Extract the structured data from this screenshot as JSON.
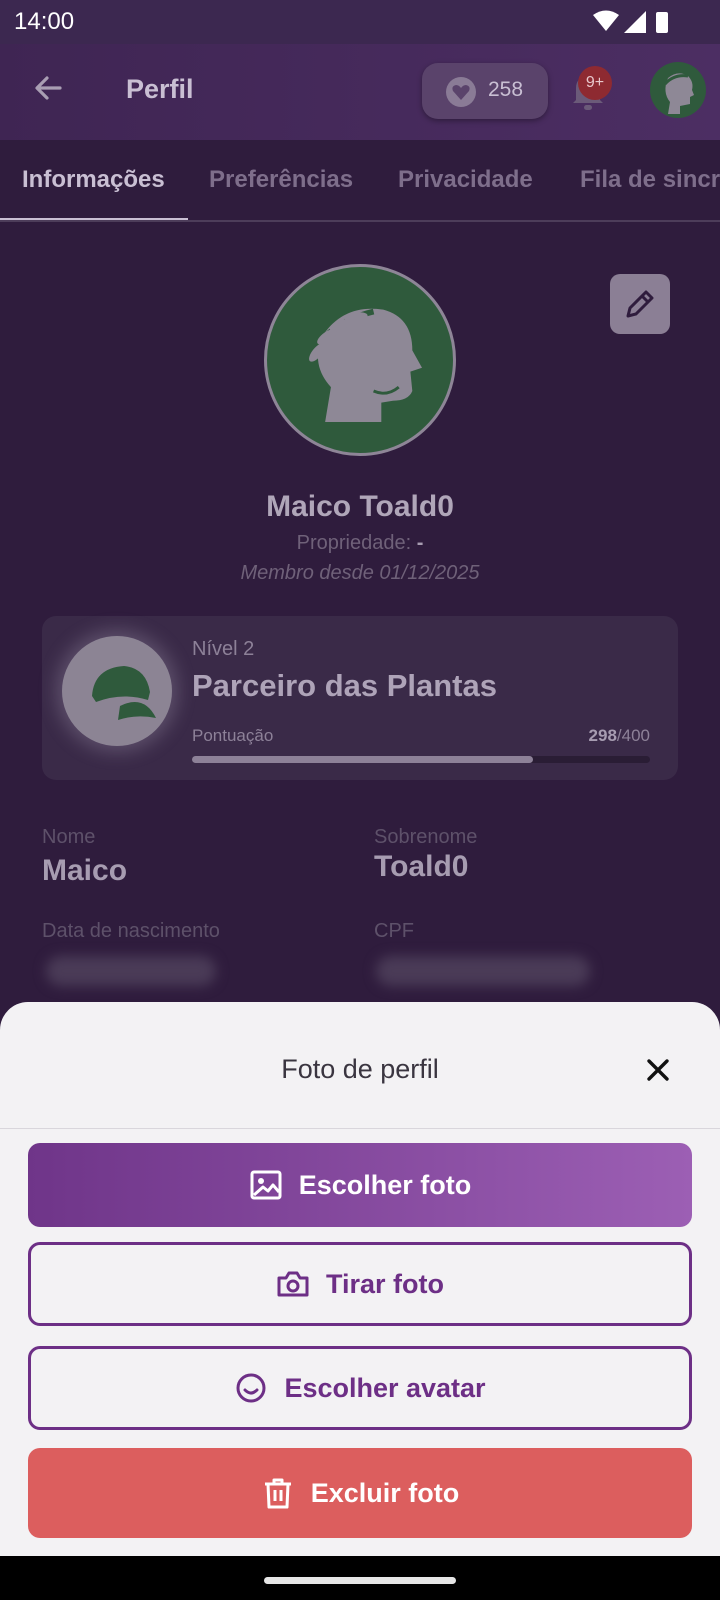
{
  "status_bar": {
    "time": "14:00"
  },
  "app_bar": {
    "title": "Perfil",
    "points": "258",
    "notification_badge": "9+",
    "icons": [
      "arrow-back-icon",
      "heart-icon",
      "bell-icon",
      "avatar-laurel-icon"
    ]
  },
  "tabs": [
    "Informações",
    "Preferências",
    "Privacidade",
    "Fila de sincr"
  ],
  "profile": {
    "name": "Maico Toald0",
    "property_label": "Propriedade:",
    "property_value": "-",
    "member_since": "Membro desde 01/12/2025"
  },
  "level": {
    "label": "Nível 2",
    "title": "Parceiro das Plantas",
    "score_label": "Pontuação",
    "score": "298",
    "score_max": "/400",
    "progress_fraction": 0.745
  },
  "fields": {
    "first_name_label": "Nome",
    "first_name": "Maico",
    "last_name_label": "Sobrenome",
    "last_name": "Toald0",
    "birth_label": "Data de nascimento",
    "cpf_label": "CPF"
  },
  "sheet": {
    "title": "Foto de perfil",
    "choose_photo": "Escolher foto",
    "take_photo": "Tirar foto",
    "choose_avatar": "Escolher avatar",
    "delete_photo": "Excluir foto"
  },
  "colors": {
    "primary": "#6d2f86",
    "primary_light": "#9c5fb4",
    "danger": "#dc5e5e",
    "sheet_bg": "#f3f2f4",
    "scrim_bg": "#2f1c3d"
  }
}
